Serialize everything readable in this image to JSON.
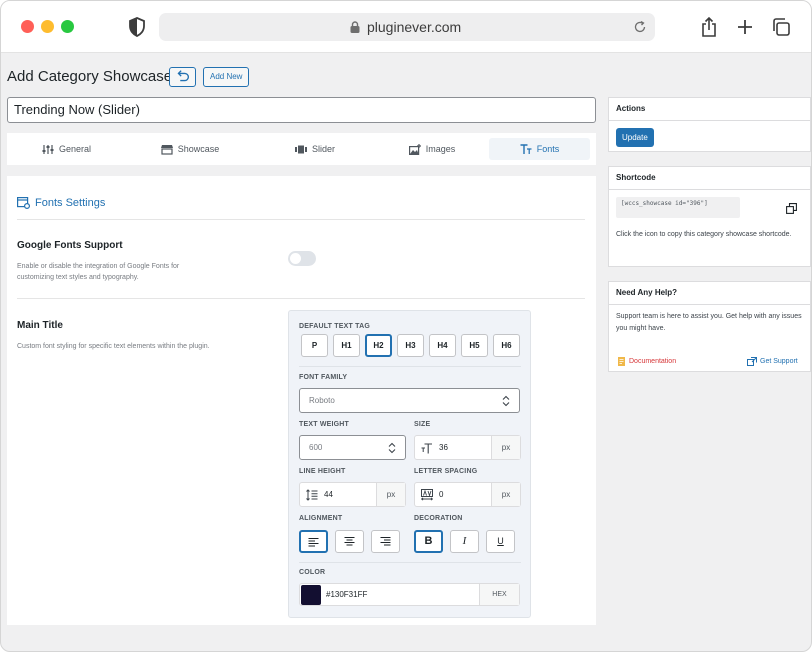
{
  "browser": {
    "url": "pluginever.com"
  },
  "page": {
    "title": "Add Category Showcase",
    "add_new": "Add New",
    "post_title": "Trending Now (Slider)"
  },
  "tabs": [
    {
      "label": "General",
      "icon": "sliders-icon"
    },
    {
      "label": "Showcase",
      "icon": "storefront-icon"
    },
    {
      "label": "Slider",
      "icon": "slides-icon"
    },
    {
      "label": "Images",
      "icon": "images-icon"
    },
    {
      "label": "Fonts",
      "icon": "text-size-icon",
      "active": true
    }
  ],
  "panel": {
    "heading": "Fonts Settings",
    "google_fonts": {
      "title": "Google Fonts Support",
      "desc": "Enable or disable the integration of Google Fonts for customizing text styles and typography.",
      "enabled": false
    },
    "main_title": {
      "title": "Main Title",
      "desc": "Custom font styling for specific text elements within the plugin."
    },
    "fonts": {
      "tag_label": "DEFAULT TEXT TAG",
      "tags": [
        "P",
        "H1",
        "H2",
        "H3",
        "H4",
        "H5",
        "H6"
      ],
      "selected_tag": "H2",
      "family_label": "FONT FAMILY",
      "family_value": "Roboto",
      "weight_label": "TEXT WEIGHT",
      "weight_value": "600",
      "size_label": "SIZE",
      "size_value": "36",
      "size_unit": "px",
      "line_height_label": "LINE HEIGHT",
      "line_height_value": "44",
      "line_height_unit": "px",
      "letter_spacing_label": "LETTER SPACING",
      "letter_spacing_value": "0",
      "letter_spacing_unit": "px",
      "alignment_label": "ALIGNMENT",
      "alignment_selected": "left",
      "decoration_label": "DECORATION",
      "decoration_bold": "B",
      "decoration_italic": "I",
      "decoration_underline": "U",
      "decoration_selected": "bold",
      "color_label": "COLOR",
      "color_value": "#130F31FF",
      "color_swatch": "#130f31",
      "color_format": "HEX"
    }
  },
  "sidebar": {
    "actions": {
      "title": "Actions",
      "update": "Update"
    },
    "shortcode": {
      "title": "Shortcode",
      "code": "[wccs_showcase id=\"396\"]",
      "desc": "Click the icon to copy this category showcase shortcode."
    },
    "help": {
      "title": "Need Any Help?",
      "desc": "Support team is here to assist you. Get help with any issues you might have.",
      "documentation": "Documentation",
      "support": "Get Support"
    }
  },
  "colors": {
    "accent": "#2271b1",
    "doc_link": "#d63638"
  }
}
